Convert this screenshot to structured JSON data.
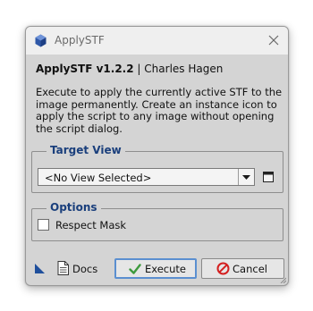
{
  "window": {
    "title": "ApplySTF",
    "app_icon": "pixinsight-logo-icon",
    "close_icon": "close-icon"
  },
  "header": {
    "name": "ApplySTF v1.2.2",
    "separator": "|",
    "author": "Charles Hagen"
  },
  "description": "Execute to apply the currently active STF to the image permanently. Create an instance icon to apply the script to any image without opening the script dialog.",
  "target_view": {
    "title": "Target View",
    "selected": "<No View Selected>",
    "dropdown_icon": "chevron-down-icon",
    "select_view_icon": "window-icon"
  },
  "options": {
    "title": "Options",
    "respect_mask_label": "Respect Mask",
    "respect_mask_checked": false
  },
  "footer": {
    "new_instance_icon": "new-instance-triangle-icon",
    "docs_label": "Docs",
    "docs_icon": "document-icon",
    "execute_label": "Execute",
    "execute_icon": "checkmark-icon",
    "cancel_label": "Cancel",
    "cancel_icon": "cancel-circle-icon",
    "colors": {
      "execute_check": "#3d9a3d",
      "cancel_red": "#d42020",
      "accent_blue": "#1a3f7c",
      "focus_border": "#5b8fd0"
    }
  }
}
